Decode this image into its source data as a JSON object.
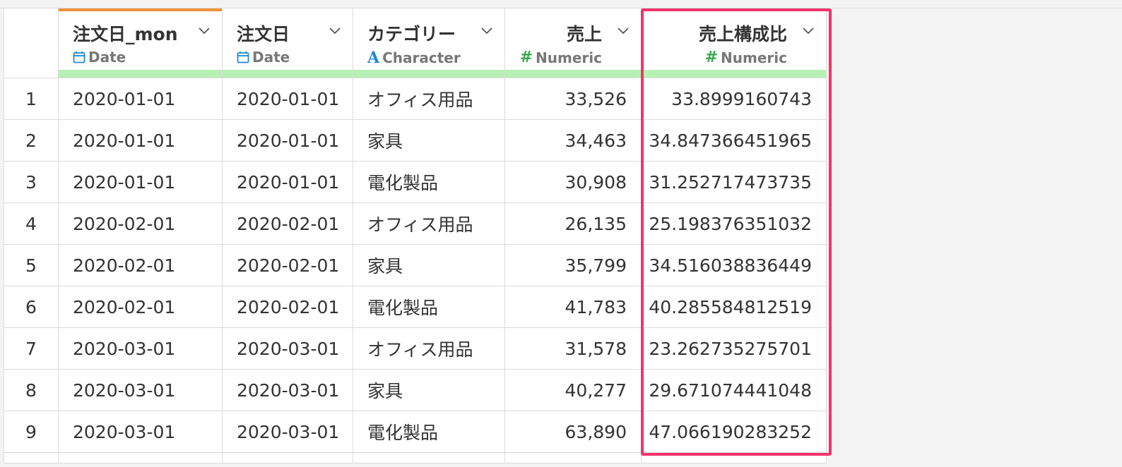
{
  "columns": [
    {
      "name": "注文日_mon",
      "type": "Date",
      "icon": "calendar-icon"
    },
    {
      "name": "注文日",
      "type": "Date",
      "icon": "calendar-icon"
    },
    {
      "name": "カテゴリー",
      "type": "Character",
      "icon": "character-a-icon"
    },
    {
      "name": "売上",
      "type": "Numeric",
      "icon": "hash-icon"
    },
    {
      "name": "売上構成比",
      "type": "Numeric",
      "icon": "hash-icon"
    }
  ],
  "rows": [
    {
      "num": "1",
      "c1": "2020-01-01",
      "c2": "2020-01-01",
      "c3": "オフィス用品",
      "c4": "33,526",
      "c5": "33.8999160743"
    },
    {
      "num": "2",
      "c1": "2020-01-01",
      "c2": "2020-01-01",
      "c3": "家具",
      "c4": "34,463",
      "c5": "34.847366451965"
    },
    {
      "num": "3",
      "c1": "2020-01-01",
      "c2": "2020-01-01",
      "c3": "電化製品",
      "c4": "30,908",
      "c5": "31.252717473735"
    },
    {
      "num": "4",
      "c1": "2020-02-01",
      "c2": "2020-02-01",
      "c3": "オフィス用品",
      "c4": "26,135",
      "c5": "25.198376351032"
    },
    {
      "num": "5",
      "c1": "2020-02-01",
      "c2": "2020-02-01",
      "c3": "家具",
      "c4": "35,799",
      "c5": "34.516038836449"
    },
    {
      "num": "6",
      "c1": "2020-02-01",
      "c2": "2020-02-01",
      "c3": "電化製品",
      "c4": "41,783",
      "c5": "40.285584812519"
    },
    {
      "num": "7",
      "c1": "2020-03-01",
      "c2": "2020-03-01",
      "c3": "オフィス用品",
      "c4": "31,578",
      "c5": "23.262735275701"
    },
    {
      "num": "8",
      "c1": "2020-03-01",
      "c2": "2020-03-01",
      "c3": "家具",
      "c4": "40,277",
      "c5": "29.671074441048"
    },
    {
      "num": "9",
      "c1": "2020-03-01",
      "c2": "2020-03-01",
      "c3": "電化製品",
      "c4": "63,890",
      "c5": "47.066190283252"
    }
  ],
  "colors": {
    "highlight": "#f3336b",
    "selected_column_accent": "#f0913a",
    "quality_bar": "#b6f0b4",
    "numeric_icon": "#3aa651",
    "date_icon": "#1e88d6"
  }
}
